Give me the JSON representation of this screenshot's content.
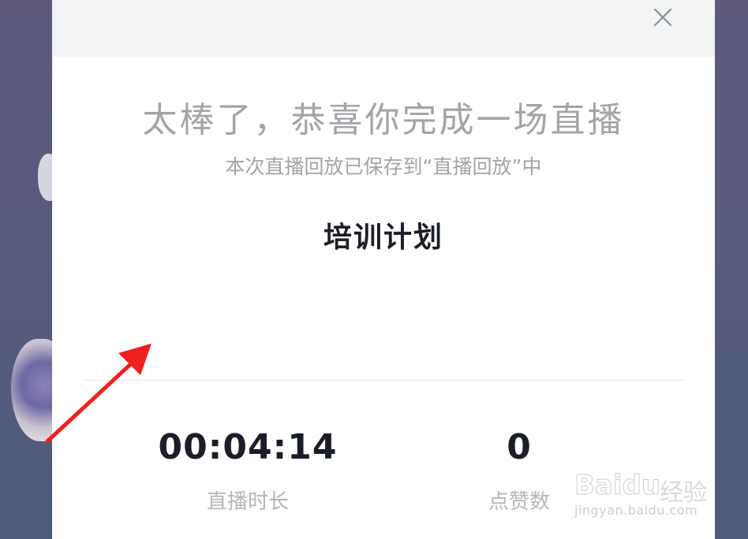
{
  "modal": {
    "title": "太棒了，恭喜你完成一场直播",
    "subtitle": "本次直播回放已保存到“直播回放”中",
    "plan_title": "培训计划",
    "stats": {
      "duration_value": "00:04:14",
      "duration_label": "直播时长",
      "likes_value": "0",
      "likes_label": "点赞数"
    }
  },
  "watermark": {
    "brand": "Baidu",
    "suffix": "经验",
    "url": "jingyan.baidu.com"
  },
  "colors": {
    "annotation_arrow": "#f0201f",
    "title_gray": "#a3a4a8",
    "header_bg": "#f3f4f6"
  },
  "icons": {
    "close": "close-icon"
  }
}
